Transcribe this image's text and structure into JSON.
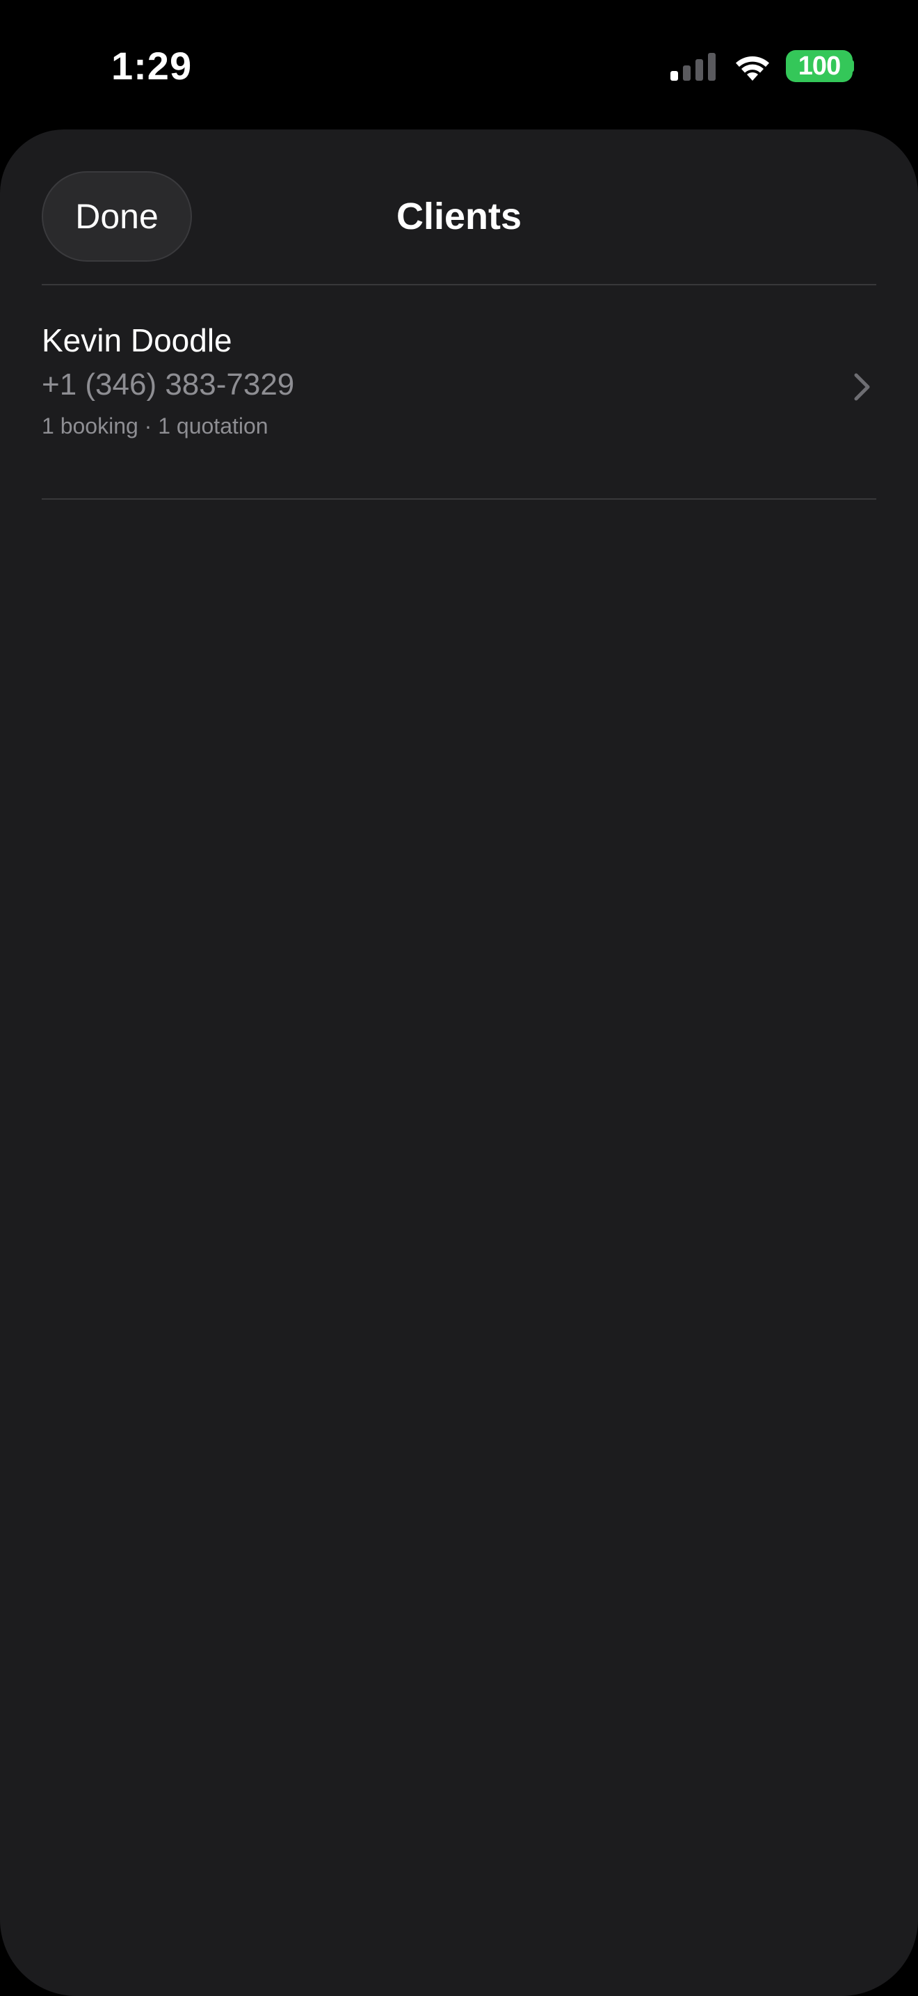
{
  "status_bar": {
    "time": "1:29",
    "battery_level": "100",
    "signal_bars_active": 1,
    "signal_bars_total": 4,
    "battery_color": "#34c759"
  },
  "nav": {
    "done_label": "Done",
    "title": "Clients"
  },
  "clients": [
    {
      "name": "Kevin Doodle",
      "phone": "+1 (346) 383-7329",
      "meta": "1 booking · 1 quotation"
    }
  ],
  "theme": {
    "background": "#000000",
    "sheet": "#1c1c1e",
    "secondary_text": "#8e8e93"
  }
}
